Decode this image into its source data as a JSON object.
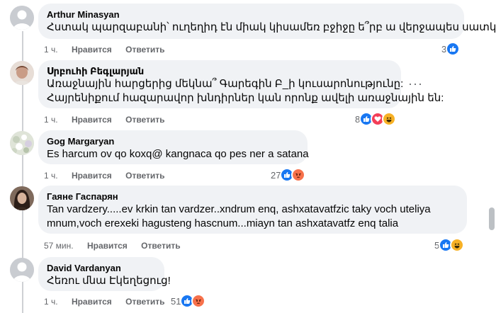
{
  "comments": [
    {
      "author": "Arthur Minasyan",
      "lines": [
        "Հստակ պարզաբանի՝ ուղեղիդ էն միակ կիսամեռ բջիջը ե՞րբ ա վերջապես սատկելու"
      ],
      "time": "1 ч.",
      "like_label": "Нравится",
      "reply_label": "Ответить",
      "reaction_count": "3",
      "reactions": [
        "like-icon"
      ],
      "avatar": "default"
    },
    {
      "author": "Սրբուհի Բեգլարյան",
      "lines": [
        "Առաջնային հարցերից մեկնա՞ Գարեգին Բ_ի կուսարոնությունը:",
        "Հայրենիքում հազարավոր խնդիրներ կան որոնք ավելի առաջնային են:"
      ],
      "time": "1 ч.",
      "like_label": "Нравится",
      "reply_label": "Ответить",
      "reaction_count": "8",
      "reactions": [
        "like-icon",
        "love-icon",
        "haha-icon"
      ],
      "avatar": "photo-woman"
    },
    {
      "author": "Gog Margaryan",
      "lines": [
        "Es harcum ov qo koxq@ kangnaca qo pes ner a satana"
      ],
      "time": "1 ч.",
      "like_label": "Нравится",
      "reply_label": "Ответить",
      "reaction_count": "27",
      "reactions": [
        "like-icon",
        "angry-icon"
      ],
      "avatar": "photo-flowers"
    },
    {
      "author": "Гаяне Гаспарян",
      "lines": [
        "Tan vardzery.....ev krkin tan vardzer..xndrum enq, ashxatavatfzic taky voch uteliya",
        "mnum,voch erexeki hagusteng hascnum...miayn tan ashxatavatfz enq talia"
      ],
      "time": "57 мин.",
      "like_label": "Нравится",
      "reply_label": "Ответить",
      "reaction_count": "5",
      "reactions": [
        "like-icon",
        "haha-icon"
      ],
      "avatar": "photo-woman-dark"
    },
    {
      "author": "David Vardanyan",
      "lines": [
        "Հեռու մնա Էկեղեցուց!"
      ],
      "time": "1 ч.",
      "like_label": "Нравится",
      "reply_label": "Ответить",
      "reaction_count": "51",
      "reactions": [
        "like-icon",
        "angry-icon"
      ],
      "avatar": "default"
    }
  ],
  "more_options": "···"
}
